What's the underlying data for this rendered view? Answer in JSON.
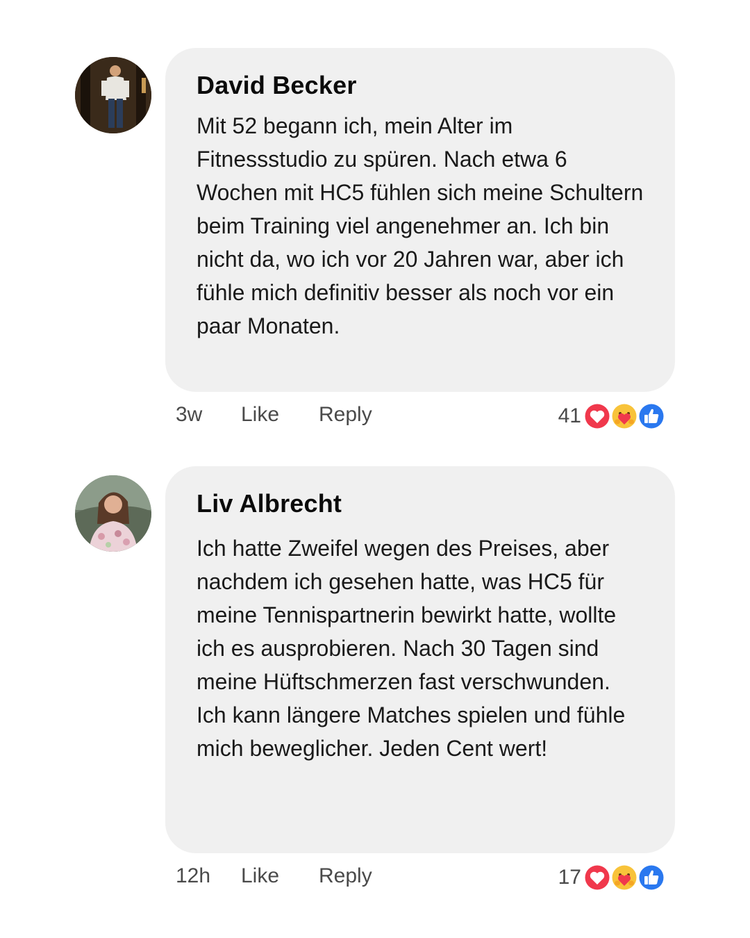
{
  "comments": [
    {
      "author": "David Becker",
      "text": "Mit 52 begann ich, mein Alter im Fitnessstudio zu spüren. Nach etwa 6 Wochen mit HC5 fühlen sich meine Schultern beim Training viel angenehmer an. Ich bin nicht da, wo ich vor 20 Jahren war, aber ich fühle mich definitiv besser als noch vor ein paar Monaten.",
      "time": "3w",
      "like_label": "Like",
      "reply_label": "Reply",
      "reaction_count": "41",
      "reactions": [
        "heart-reaction-icon",
        "care-reaction-icon",
        "like-reaction-icon"
      ]
    },
    {
      "author": "Liv Albrecht",
      "text": "Ich hatte Zweifel wegen des Preises, aber nachdem ich gesehen hatte, was HC5 für meine Tennispartnerin bewirkt hatte, wollte ich es ausprobieren. Nach 30 Tagen sind meine Hüftschmerzen fast verschwunden. Ich kann längere Matches spielen und fühle mich beweglicher. Jeden Cent wert!",
      "time": "12h",
      "like_label": "Like",
      "reply_label": "Reply",
      "reaction_count": "17",
      "reactions": [
        "heart-reaction-icon",
        "care-reaction-icon",
        "like-reaction-icon"
      ]
    }
  ],
  "colors": {
    "bubble": "#f0f0f0",
    "heart": "#f0384c",
    "like": "#2a78ef",
    "care": "#f8c33a"
  }
}
